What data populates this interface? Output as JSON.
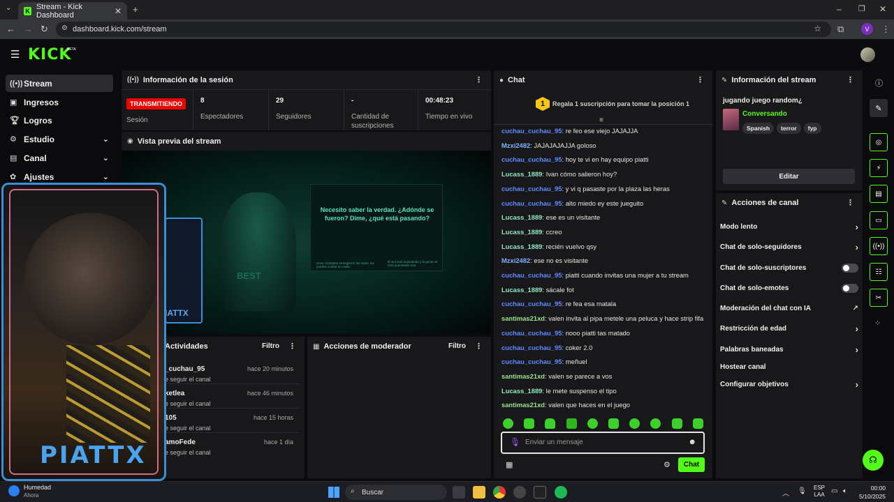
{
  "browser": {
    "tab_title": "Stream - Kick Dashboard",
    "url": "dashboard.kick.com/stream",
    "profile_letter": "V"
  },
  "logo": {
    "text": "KICK",
    "beta": "BETA"
  },
  "sidebar": {
    "items": [
      {
        "label": "Stream",
        "icon": "broadcast-icon"
      },
      {
        "label": "Ingresos",
        "icon": "cash-icon"
      },
      {
        "label": "Logros",
        "icon": "trophy-icon"
      },
      {
        "label": "Estudio",
        "icon": "studio-icon"
      },
      {
        "label": "Canal",
        "icon": "channel-icon"
      },
      {
        "label": "Ajustes",
        "icon": "gear-icon"
      }
    ]
  },
  "session": {
    "title": "Información de la sesión",
    "status": "TRANSMITIENDO",
    "status_label": "Sesión",
    "viewers_value": "8",
    "viewers_label": "Espectadores",
    "followers_value": "29",
    "followers_label": "Seguidores",
    "subs_value": "-",
    "subs_label": "Cantidad de suscripciones",
    "time_value": "00:48:23",
    "time_label": "Tiempo en vivo"
  },
  "preview": {
    "title": "Vista previa del stream",
    "overlay_text": "Necesito saber la verdad. ¿Adónde se fueron? Dime, ¿qué está pasando?",
    "sub_text_1": "Unos Visitantes emergieron del suelo. No puedes confiar en nadie.",
    "sub_text_2": "El Sol está explotando y la gente se está quemando viva.",
    "shirt_text": "BEST",
    "cam_name": "IATTX"
  },
  "activity": {
    "title": "Actividades",
    "filter": "Filtro",
    "rows": [
      {
        "name": "_cuchau_95",
        "sub": "e seguir el canal",
        "time": "hace 20 minutos"
      },
      {
        "name": "ketlea",
        "sub": "e seguir el canal",
        "time": "hace 46 minutos"
      },
      {
        "name": "105",
        "sub": "e seguir el canal",
        "time": "hace 15 horas"
      },
      {
        "name": "amoFede",
        "sub": "e seguir el canal",
        "time": "hace 1 día"
      }
    ]
  },
  "modactions": {
    "title": "Acciones de moderador",
    "filter": "Filtro"
  },
  "webcam": {
    "name": "PIATTX"
  },
  "chat": {
    "title": "Chat",
    "gift_rank": "1",
    "gift_text": "Regala 1 suscripción para tomar la posición 1",
    "messages": [
      {
        "user": "cuchau_cuchau_95",
        "color": "#5b8cff",
        "text": "re feo ese viejo JAJAJJA"
      },
      {
        "user": "Mzxi2482",
        "color": "#7fb3ff",
        "text": "JAJAJAJAJJA goloso"
      },
      {
        "user": "cuchau_cuchau_95",
        "color": "#5b8cff",
        "text": "hoy te vi en hay equipo piatti"
      },
      {
        "user": "Lucass_1889",
        "color": "#8ee6c4",
        "text": "Ivan cómo salieron hoy?"
      },
      {
        "user": "cuchau_cuchau_95",
        "color": "#5b8cff",
        "text": "y vi q pasaste por la plaza las heras"
      },
      {
        "user": "cuchau_cuchau_95",
        "color": "#5b8cff",
        "text": "alto miedo ey este jueguito"
      },
      {
        "user": "Lucass_1889",
        "color": "#8ee6c4",
        "text": "ese es un visitante"
      },
      {
        "user": "Lucass_1889",
        "color": "#8ee6c4",
        "text": "ccreo"
      },
      {
        "user": "Lucass_1889",
        "color": "#8ee6c4",
        "text": "recién vuelvo qsy"
      },
      {
        "user": "Mzxi2482",
        "color": "#7fb3ff",
        "text": "ese no es visitante"
      },
      {
        "user": "cuchau_cuchau_95",
        "color": "#5b8cff",
        "text": "piatti cuando invitas una mujer a tu stream"
      },
      {
        "user": "Lucass_1889",
        "color": "#8ee6c4",
        "text": "sácale fot"
      },
      {
        "user": "cuchau_cuchau_95",
        "color": "#5b8cff",
        "text": "re fea esa matala"
      },
      {
        "user": "santimas21xd",
        "color": "#9be28a",
        "text": "valen invita al pipa metele una peluca y hace strip fifa"
      },
      {
        "user": "cuchau_cuchau_95",
        "color": "#5b8cff",
        "text": "nooo piatti tas matado"
      },
      {
        "user": "cuchau_cuchau_95",
        "color": "#5b8cff",
        "text": "coker 2.0"
      },
      {
        "user": "cuchau_cuchau_95",
        "color": "#5b8cff",
        "text": "meñuel"
      },
      {
        "user": "santimas21xd",
        "color": "#9be28a",
        "text": "valen se parece a vos"
      },
      {
        "user": "Lucass_1889",
        "color": "#8ee6c4",
        "text": "le mete suspenso el tipo"
      },
      {
        "user": "santimas21xd",
        "color": "#9be28a",
        "text": "valen que haces en el juego"
      }
    ],
    "input_placeholder": "Enviar un mensaje",
    "send_label": "Chat"
  },
  "stream_info": {
    "title": "Información del stream",
    "stream_title": "jugando juego random¿",
    "category": "Conversando",
    "tags": [
      "Spanish",
      "terror",
      "fyp"
    ],
    "edit_label": "Editar"
  },
  "channel_actions": {
    "title": "Acciones de canal",
    "rows": [
      {
        "label": "Modo lento",
        "control": "chevron"
      },
      {
        "label": "Chat de solo-seguidores",
        "control": "chevron"
      },
      {
        "label": "Chat de solo-suscriptores",
        "control": "toggle"
      },
      {
        "label": "Chat de solo-emotes",
        "control": "toggle"
      },
      {
        "label": "Moderación del chat con IA",
        "control": "external"
      },
      {
        "label": "Restricción de edad",
        "control": "chevron"
      },
      {
        "label": "Palabras baneadas",
        "control": "chevron"
      },
      {
        "label": "Hostear canal",
        "control": "none"
      },
      {
        "label": "Configurar objetivos",
        "control": "chevron"
      }
    ]
  },
  "taskbar": {
    "weather_label": "Humedad",
    "weather_sub": "Ahora",
    "search_label": "Buscar",
    "lang_1": "ESP",
    "lang_2": "LAA",
    "time": "00:00",
    "date": "5/10/2025"
  },
  "colors": {
    "accent": "#53fc18",
    "live": "#eb0400",
    "panel": "#18181b"
  }
}
